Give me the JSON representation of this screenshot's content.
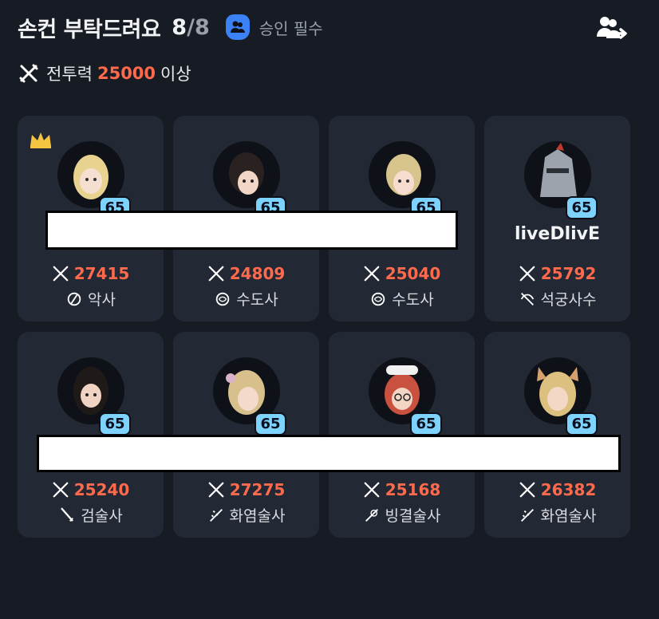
{
  "header": {
    "title": "손컨 부탁드려요",
    "count_current": "8",
    "count_sep": "/",
    "count_max": "8",
    "approval_label": "승인 필수"
  },
  "requirement": {
    "prefix": "전투력",
    "value": "25000",
    "suffix": "이상"
  },
  "members": [
    {
      "name": "",
      "level": "65",
      "power": "27415",
      "job": "악사",
      "leader": true
    },
    {
      "name": "",
      "level": "65",
      "power": "24809",
      "job": "수도사",
      "leader": false
    },
    {
      "name": "",
      "level": "65",
      "power": "25040",
      "job": "수도사",
      "leader": false
    },
    {
      "name": "liveDlivE",
      "level": "65",
      "power": "25792",
      "job": "석궁사수",
      "leader": false
    },
    {
      "name": "",
      "level": "65",
      "power": "25240",
      "job": "검술사",
      "leader": false
    },
    {
      "name": "",
      "level": "65",
      "power": "27275",
      "job": "화염술사",
      "leader": false
    },
    {
      "name": "",
      "level": "65",
      "power": "25168",
      "job": "빙결술사",
      "leader": false
    },
    {
      "name": "",
      "level": "65",
      "power": "26382",
      "job": "화염술사",
      "leader": false
    }
  ],
  "colors": {
    "background": "#161b24",
    "card": "#222834",
    "power_accent": "#ff6a4d",
    "level_badge": "#7dd3fc",
    "approval_icon": "#3b82f6"
  }
}
